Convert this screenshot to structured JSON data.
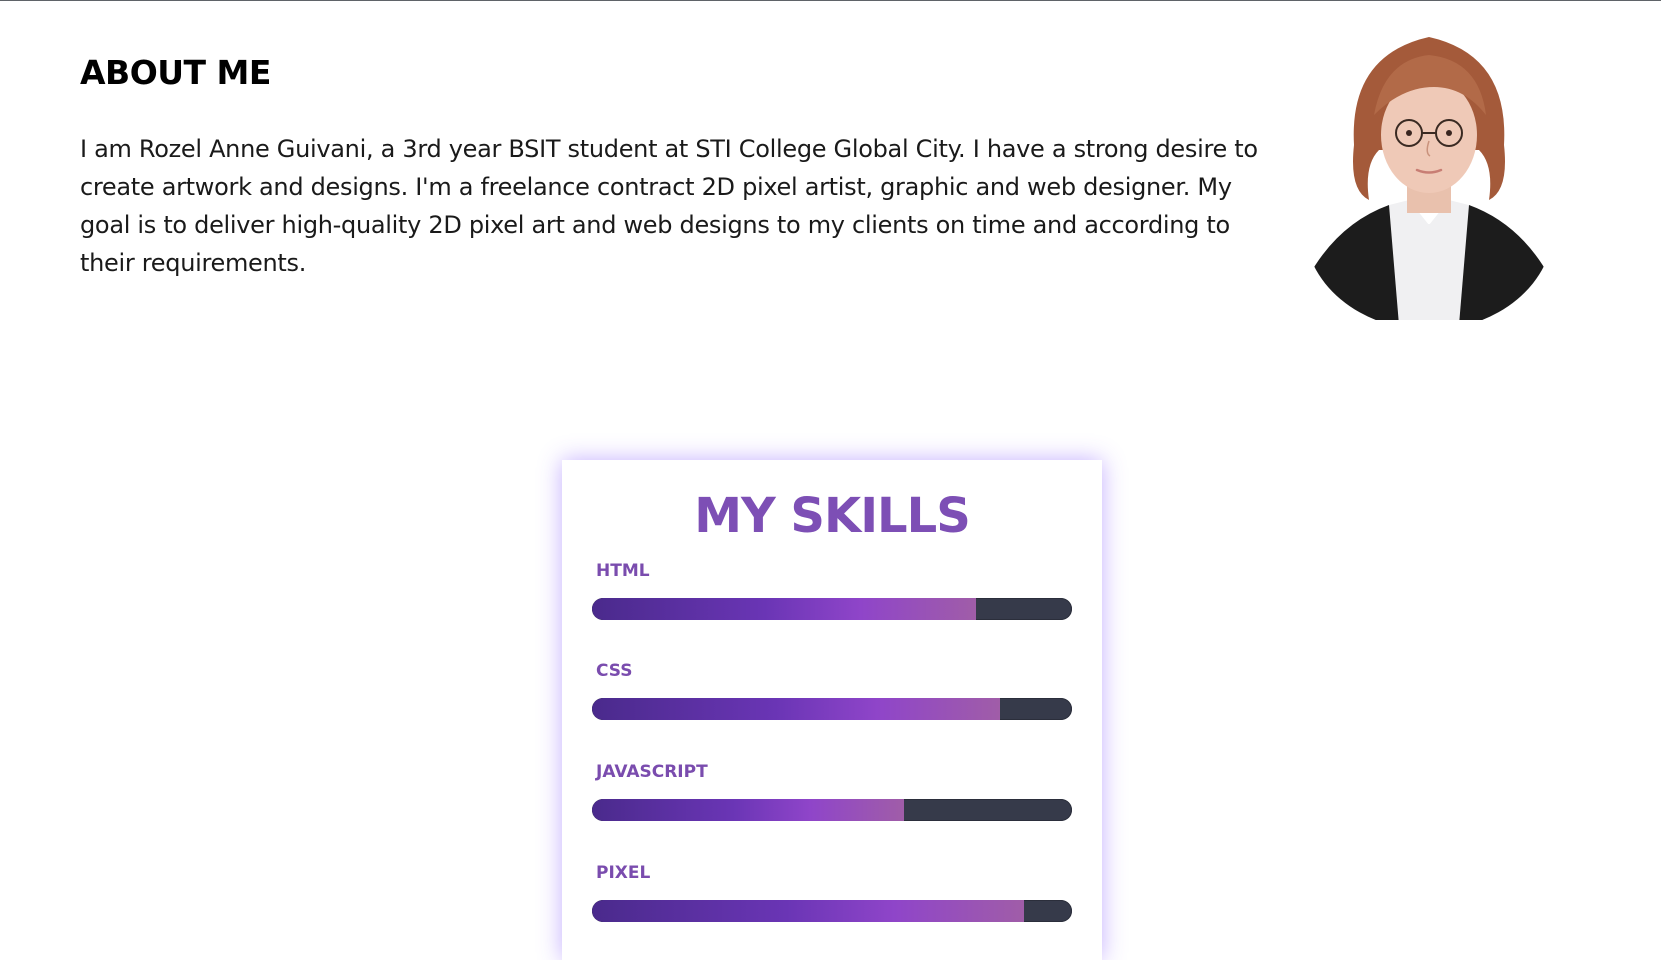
{
  "about": {
    "title": "ABOUT ME",
    "text": "I am Rozel Anne Guivani, a 3rd year BSIT student at STI College Global City. I have a strong desire to create artwork and designs. I'm a freelance contract 2D pixel artist, graphic and web designer. My goal is to deliver high-quality 2D pixel art and web designs to my clients on time and according to their requirements."
  },
  "avatar": {
    "icon": "profile-photo"
  },
  "skills": {
    "title": "MY SKILLS",
    "items": [
      {
        "label": "HTML",
        "percent": 80
      },
      {
        "label": "CSS",
        "percent": 85
      },
      {
        "label": "JAVASCRIPT",
        "percent": 65
      },
      {
        "label": "PIXEL",
        "percent": 90
      }
    ]
  },
  "colors": {
    "accent": "#7d4fb5",
    "track": "#363a4a",
    "glow": "#7c4dff"
  }
}
